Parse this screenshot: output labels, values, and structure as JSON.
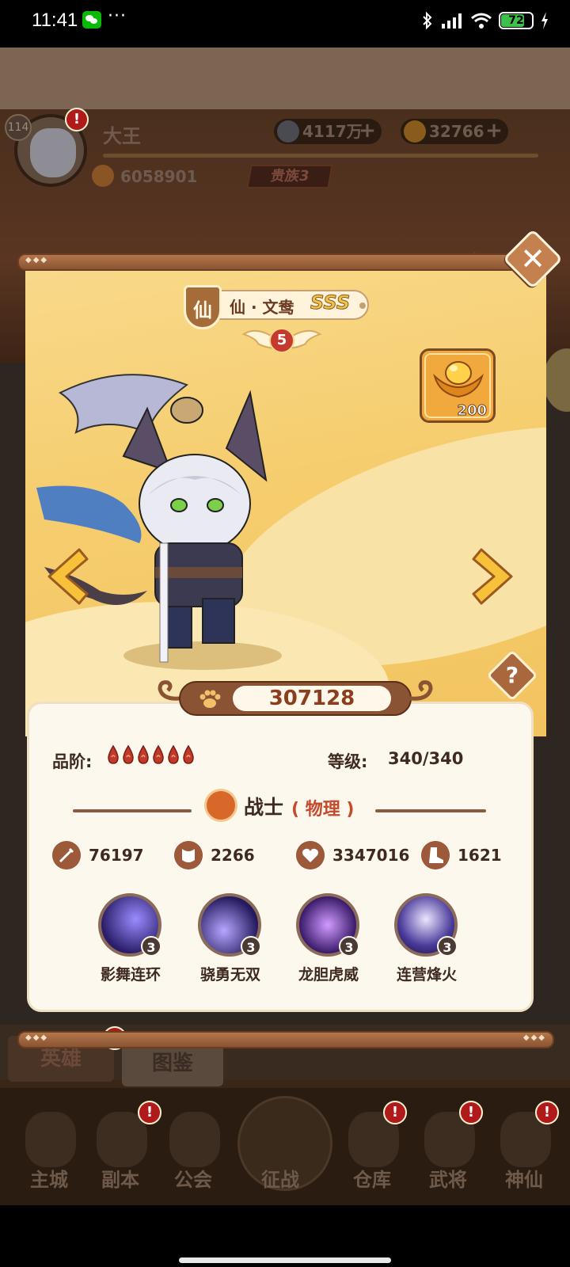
{
  "status_bar": {
    "time": "11:41",
    "more": "···",
    "battery": "72"
  },
  "header": {
    "level": "114",
    "player_name": "大王",
    "coins": "4117万",
    "ingots": "32766",
    "paw_points": "6058901",
    "vip": "贵族3"
  },
  "hero": {
    "race": "仙",
    "name": "仙 · 文鸯",
    "grade": "SSS",
    "stars": "5",
    "reward_count": "200",
    "power": "307128",
    "quality_label": "品阶:",
    "quality_drops": 6,
    "level_label": "等级:",
    "level_value": "340/340",
    "class_name": "战士",
    "class_type": "( 物理 )",
    "stats": {
      "attack": "76197",
      "defense": "2266",
      "hp": "3347016",
      "speed": "1621"
    },
    "skills": [
      {
        "name": "影舞连环",
        "level": "3"
      },
      {
        "name": "骁勇无双",
        "level": "3"
      },
      {
        "name": "龙胆虎威",
        "level": "3"
      },
      {
        "name": "连营烽火",
        "level": "3"
      }
    ]
  },
  "tabs": {
    "hero": "英雄",
    "album": "图鉴"
  },
  "nav": [
    {
      "label": "主城"
    },
    {
      "label": "副本"
    },
    {
      "label": "公会"
    },
    {
      "label": "征战"
    },
    {
      "label": "仓库"
    },
    {
      "label": "武将"
    },
    {
      "label": "神仙"
    }
  ],
  "alerts": {
    "mark": "!"
  },
  "colors": {
    "modal_bg": "#f6cd6e",
    "panel_bg": "#fdf8ee",
    "accent_red": "#c54a2c",
    "frame_brown": "#8a5434"
  }
}
